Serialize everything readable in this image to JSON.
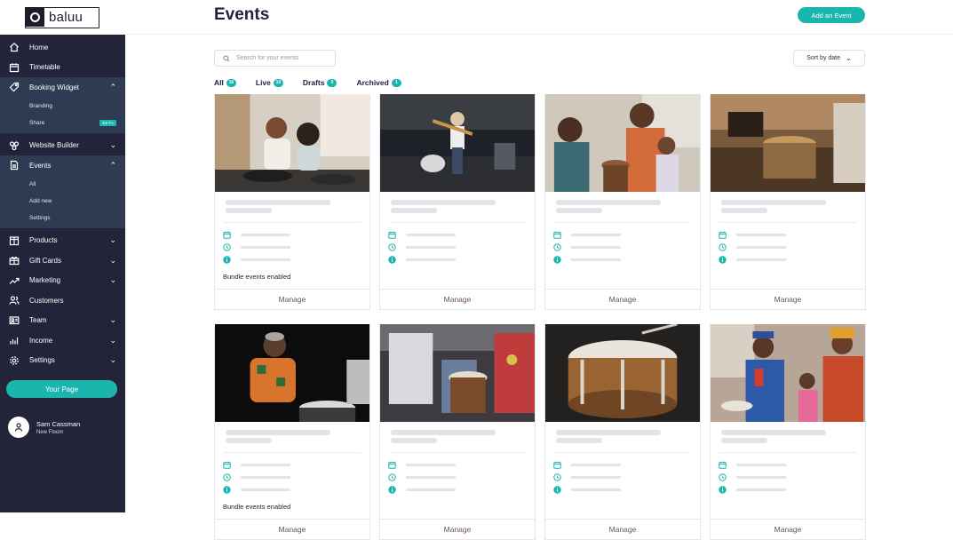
{
  "brand": {
    "logo_text": "baluu"
  },
  "header": {
    "title": "Events",
    "add_button": "Add an Event"
  },
  "sidebar": {
    "items": [
      {
        "label": "Home",
        "icon": "home-icon"
      },
      {
        "label": "Timetable",
        "icon": "calendar-icon"
      },
      {
        "label": "Booking Widget",
        "icon": "tag-icon",
        "open": true,
        "children": [
          {
            "label": "Branding"
          },
          {
            "label": "Share",
            "badge": "BETA"
          }
        ]
      },
      {
        "label": "Website Builder",
        "icon": "website-icon"
      },
      {
        "label": "Events",
        "icon": "document-icon",
        "open": true,
        "children": [
          {
            "label": "All"
          },
          {
            "label": "Add new"
          },
          {
            "label": "Settings"
          }
        ]
      },
      {
        "label": "Products",
        "icon": "box-icon"
      },
      {
        "label": "Gift Cards",
        "icon": "gift-icon"
      },
      {
        "label": "Marketing",
        "icon": "trend-icon"
      },
      {
        "label": "Customers",
        "icon": "users-icon"
      },
      {
        "label": "Team",
        "icon": "team-icon"
      },
      {
        "label": "Income",
        "icon": "bar-chart-icon"
      },
      {
        "label": "Settings",
        "icon": "gear-icon"
      }
    ],
    "your_page": "Your Page",
    "user": {
      "name": "Sam Cassman",
      "org": "New Floom"
    }
  },
  "search": {
    "placeholder": "Search for your events"
  },
  "sort": {
    "label": "Sort by date"
  },
  "tabs": [
    {
      "label": "All",
      "count": "16"
    },
    {
      "label": "Live",
      "count": "10"
    },
    {
      "label": "Drafts",
      "count": "5"
    },
    {
      "label": "Archived",
      "count": "1"
    }
  ],
  "cards": [
    {
      "scene": "drum-lesson",
      "bundle": "Bundle events enabled",
      "manage": "Manage"
    },
    {
      "scene": "guitar-stage",
      "bundle": "",
      "manage": "Manage"
    },
    {
      "scene": "family-drums",
      "bundle": "",
      "manage": "Manage"
    },
    {
      "scene": "music-workshop",
      "bundle": "",
      "manage": "Manage"
    },
    {
      "scene": "elder-drummer",
      "bundle": "Bundle events enabled",
      "manage": "Manage"
    },
    {
      "scene": "djembe-players",
      "bundle": "",
      "manage": "Manage"
    },
    {
      "scene": "snare-drum",
      "bundle": "",
      "manage": "Manage"
    },
    {
      "scene": "family-celebration",
      "bundle": "",
      "manage": "Manage"
    }
  ],
  "colors": {
    "accent": "#1ab5ad",
    "sidebar": "#23233a",
    "sidebar_open": "#2f3b52"
  }
}
